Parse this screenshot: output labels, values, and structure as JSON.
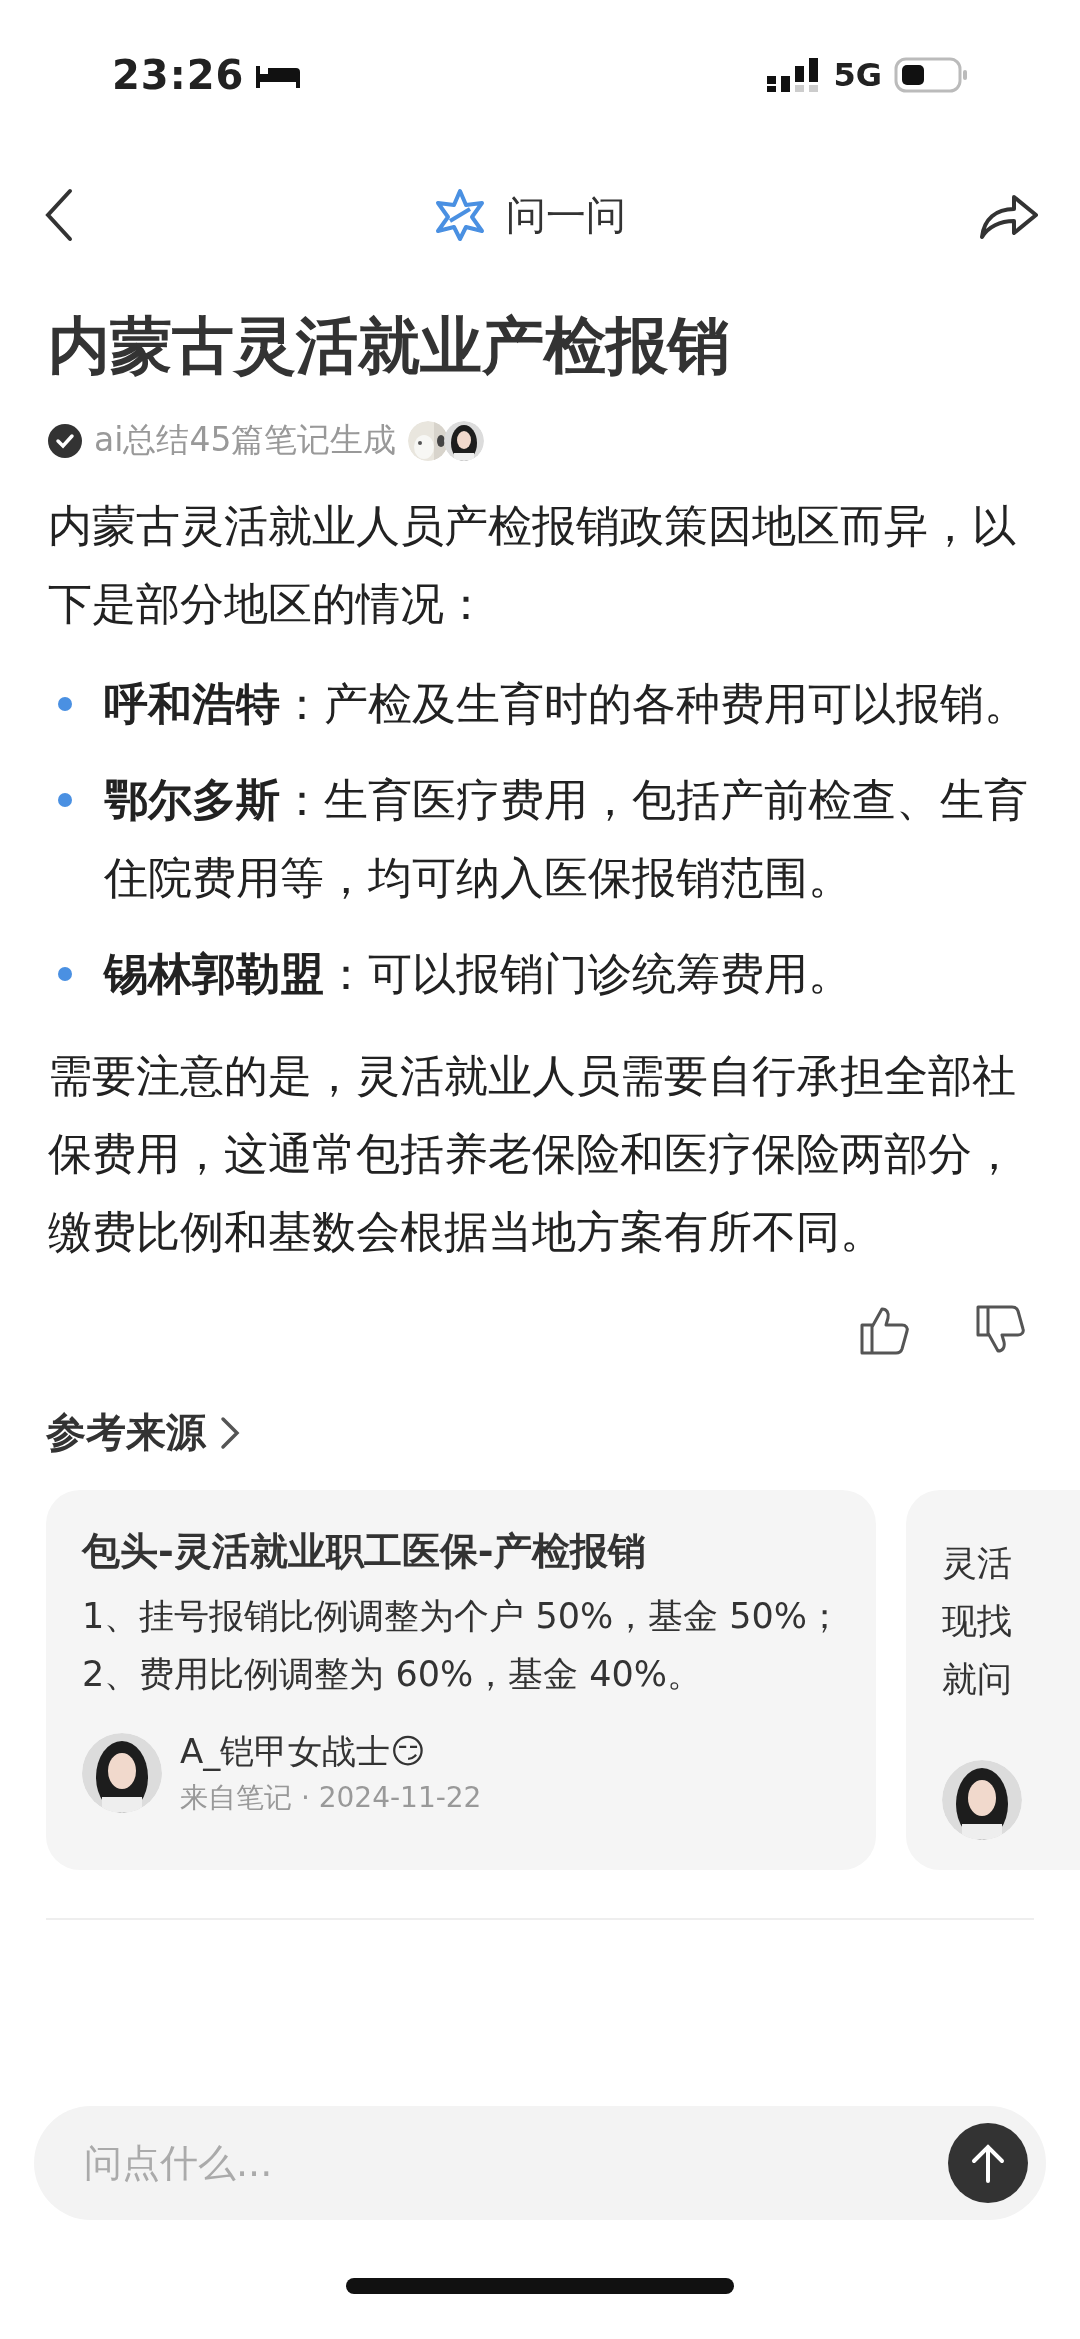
{
  "status_bar": {
    "time": "23:26",
    "network": "5G"
  },
  "nav": {
    "title": "问一问"
  },
  "title": "内蒙古灵活就业产检报销",
  "meta": {
    "text": "ai总结45篇笔记生成"
  },
  "intro": "内蒙古灵活就业人员产检报销政策因地区而异，以下是部分地区的情况：",
  "bullets": [
    "**呼和浩特**：产检及生育时的各种费用可以报销。",
    "**鄂尔多斯**：生育医疗费用，包括产前检查、生育住院费用等，均可纳入医保报销范围。",
    "**锡林郭勒盟**：可以报销门诊统筹费用。"
  ],
  "note": "需要注意的是，灵活就业人员需要自行承担全部社保费用，这通常包括养老保险和医疗保险两部分，缴费比例和基数会根据当地方案有所不同。",
  "sources": {
    "title": "参考来源",
    "cards": [
      {
        "title": "包头-灵活就业职工医保-产检报销",
        "lines": [
          "1、挂号报销比例调整为个户 50%，基金 50%；",
          "2、费用比例调整为 60%，基金 40%。"
        ],
        "author": "A_铠甲女战士😏",
        "source": "来自笔记 · 2024-11-22"
      },
      {
        "lines": [
          "灵活",
          "现找",
          "就问"
        ]
      }
    ]
  },
  "input": {
    "placeholder": "问点什么..."
  }
}
